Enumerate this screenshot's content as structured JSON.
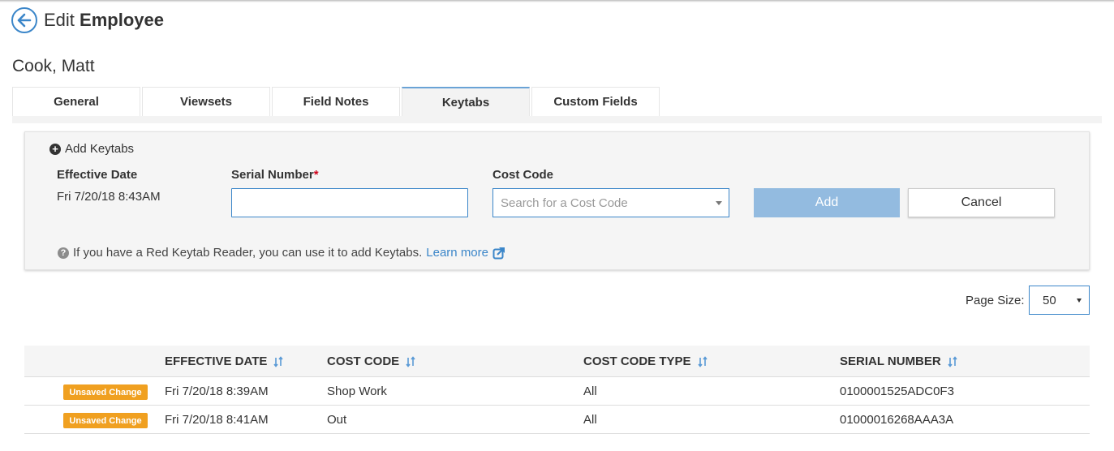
{
  "header": {
    "title_prefix": "Edit",
    "title_bold": "Employee"
  },
  "employee": {
    "name": "Cook, Matt"
  },
  "tabs": [
    {
      "label": "General",
      "active": false
    },
    {
      "label": "Viewsets",
      "active": false
    },
    {
      "label": "Field Notes",
      "active": false
    },
    {
      "label": "Keytabs",
      "active": true
    },
    {
      "label": "Custom Fields",
      "active": false
    }
  ],
  "form": {
    "add_label": "Add Keytabs",
    "effective_date_label": "Effective Date",
    "effective_date_value": "Fri 7/20/18 8:43AM",
    "serial_label": "Serial Number",
    "serial_required_mark": "*",
    "serial_value": "",
    "cost_code_label": "Cost Code",
    "cost_code_placeholder": "Search for a Cost Code",
    "add_button": "Add",
    "cancel_button": "Cancel",
    "help_text": "If you have a Red Keytab Reader, you can use it to add Keytabs.",
    "learn_more": "Learn more"
  },
  "pagination": {
    "page_size_label": "Page Size:",
    "page_size_value": "50"
  },
  "table": {
    "columns": [
      "EFFECTIVE DATE",
      "COST CODE",
      "COST CODE TYPE",
      "SERIAL NUMBER"
    ],
    "rows": [
      {
        "badge": "Unsaved Change",
        "effective_date": "Fri 7/20/18 8:39AM",
        "cost_code": "Shop Work",
        "cost_code_type": "All",
        "serial_number": "0100001525ADC0F3"
      },
      {
        "badge": "Unsaved Change",
        "effective_date": "Fri 7/20/18 8:41AM",
        "cost_code": "Out",
        "cost_code_type": "All",
        "serial_number": "01000016268AAA3A"
      }
    ]
  },
  "colors": {
    "accent": "#3b86c9",
    "add_button_bg": "#93bbe0",
    "badge_bg": "#f0a020",
    "required": "#d0021b"
  },
  "icons": {
    "back": "arrow-left-circle-icon",
    "add": "plus-circle-icon",
    "help": "question-circle-icon",
    "external": "external-link-icon",
    "sort": "sort-icon"
  }
}
